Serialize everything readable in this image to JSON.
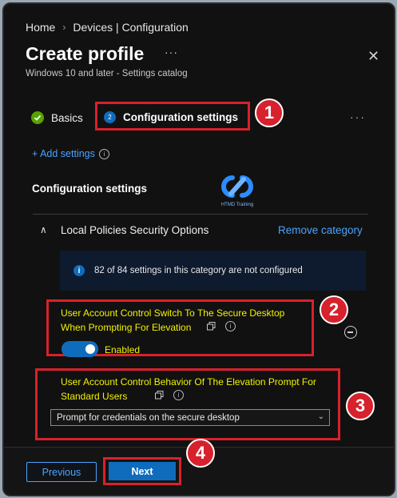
{
  "breadcrumb": {
    "home": "Home",
    "separator": "›",
    "current": "Devices | Configuration"
  },
  "header": {
    "title": "Create profile",
    "more": "···",
    "close": "✕",
    "subtitle": "Windows 10 and later - Settings catalog"
  },
  "steps": [
    {
      "label": "Basics",
      "status": "complete"
    },
    {
      "label": "Configuration settings",
      "number": "2",
      "status": "current"
    }
  ],
  "steps_more": "···",
  "callouts": [
    "1",
    "2",
    "3",
    "4"
  ],
  "add_settings": "+ Add settings",
  "section_title": "Configuration settings",
  "logo": {
    "text": "HTMD Training"
  },
  "category": {
    "chevron": "∧",
    "label": "Local Policies Security Options",
    "remove": "Remove category",
    "info": "82 of 84 settings in this category are not configured"
  },
  "setting1": {
    "label": "User Account Control Switch To The Secure Desktop When Prompting For Elevation",
    "value": "Enabled",
    "enabled": true
  },
  "setting2": {
    "label": "User Account Control Behavior Of The Elevation Prompt For Standard Users",
    "selected": "Prompt for credentials on the secure desktop"
  },
  "footer": {
    "previous": "Previous",
    "next": "Next"
  },
  "colors": {
    "accent": "#0f6cbd",
    "link": "#4aa3ff",
    "highlight_box": "#d7212c",
    "highlight_text": "#f2f200",
    "success": "#57a300"
  }
}
